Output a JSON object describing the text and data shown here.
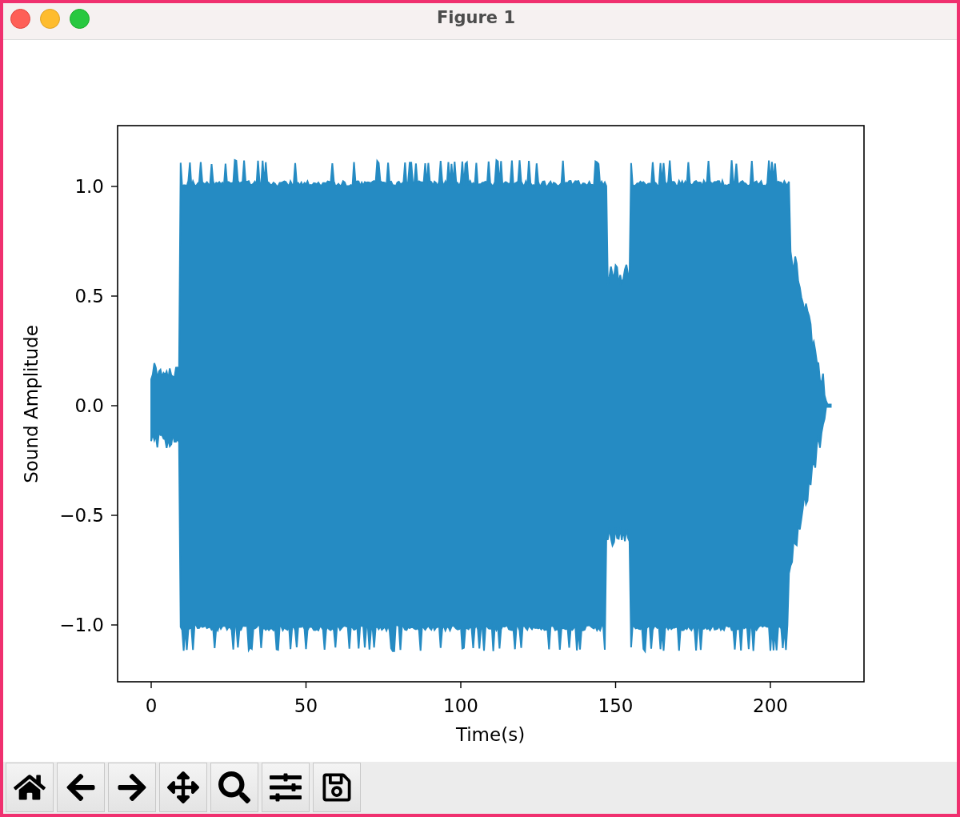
{
  "window": {
    "title": "Figure 1"
  },
  "plot": {
    "xlabel": "Time(s)",
    "ylabel": "Sound Amplitude",
    "xticks": [
      "0",
      "50",
      "100",
      "150",
      "200"
    ],
    "yticks": [
      "1.0",
      "0.5",
      "0.0",
      "−0.5",
      "−1.0"
    ]
  }
}
